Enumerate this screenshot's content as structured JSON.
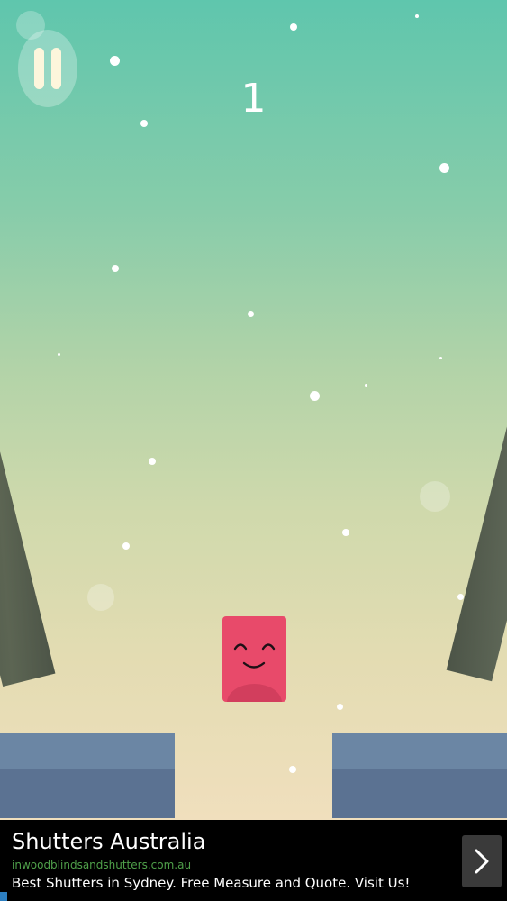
{
  "game": {
    "score": "1",
    "player_expression": "smiling"
  },
  "icons": {
    "pause": "pause-icon",
    "next": "chevron-right-icon",
    "ad_choices": "ad-choices-icon"
  },
  "colors": {
    "sky_top": "#5fc6ad",
    "sky_bottom": "#f0dfbd",
    "player_block": "#e84a6a",
    "platform_top": "#6b86a4",
    "platform_side": "#5b7292",
    "pillar": "#545d4d"
  },
  "ad": {
    "title": "Shutters Australia",
    "url": "inwoodblindsandshutters.com.au",
    "description": "Best Shutters in Sydney. Free Measure and Quote. Visit Us!"
  }
}
